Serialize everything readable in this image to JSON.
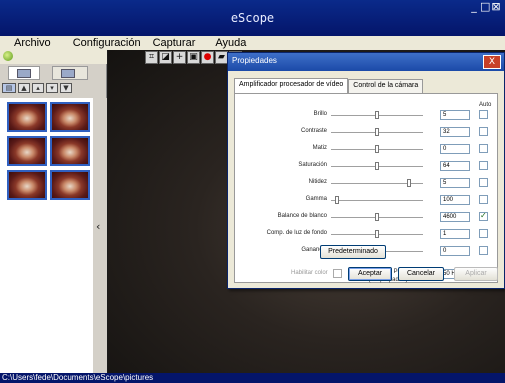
{
  "window": {
    "title": "eScope"
  },
  "menu": [
    "Archivo",
    "Configuración",
    "Capturar",
    "Ayuda"
  ],
  "status_path": "C:\\Users\\fede\\Documents\\eScope\\pictures",
  "toolbar_icons": [
    "crop-icon",
    "camera-icon",
    "crosshair-icon",
    "image-icon",
    "record-icon",
    "folder-icon",
    "camera2-icon"
  ],
  "dialog": {
    "title": "Propiedades",
    "tabs": [
      "Amplificador procesador de vídeo",
      "Control de la cámara"
    ],
    "auto_header": "Auto",
    "rows": [
      {
        "label": "Brillo",
        "value": "5",
        "slider": 0.5,
        "auto": false
      },
      {
        "label": "Contraste",
        "value": "32",
        "slider": 0.5,
        "auto": false
      },
      {
        "label": "Matiz",
        "value": "0",
        "slider": 0.5,
        "auto": false
      },
      {
        "label": "Saturación",
        "value": "64",
        "slider": 0.5,
        "auto": false
      },
      {
        "label": "Nitidez",
        "value": "5",
        "slider": 0.85,
        "auto": false
      },
      {
        "label": "Gamma",
        "value": "100",
        "slider": 0.07,
        "auto": false
      },
      {
        "label": "Balance de blanco",
        "value": "4600",
        "slider": 0.5,
        "auto": true
      },
      {
        "label": "Comp. de luz de fondo",
        "value": "1",
        "slider": 0.5,
        "auto": false
      },
      {
        "label": "Ganancia",
        "value": "0",
        "slider": 0.0,
        "auto": false
      }
    ],
    "enable_color_label": "Habilitar color",
    "powerline_label": "Frecuencia de PowerLine (antiparpadeo)",
    "powerline_value": "50 Hz",
    "default_button": "Predeterminado",
    "ok_button": "Aceptar",
    "cancel_button": "Cancelar",
    "apply_button": "Aplicar"
  }
}
